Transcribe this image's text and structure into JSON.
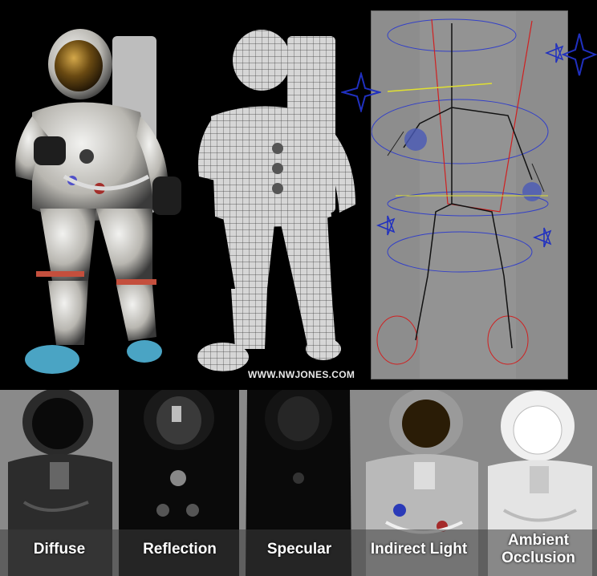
{
  "credit": "WWW.NWJONES.COM",
  "passes": [
    {
      "label": "Diffuse"
    },
    {
      "label": "Reflection"
    },
    {
      "label": "Specular"
    },
    {
      "label": "Indirect Light"
    },
    {
      "label": "Ambient\nOcclusion"
    }
  ]
}
